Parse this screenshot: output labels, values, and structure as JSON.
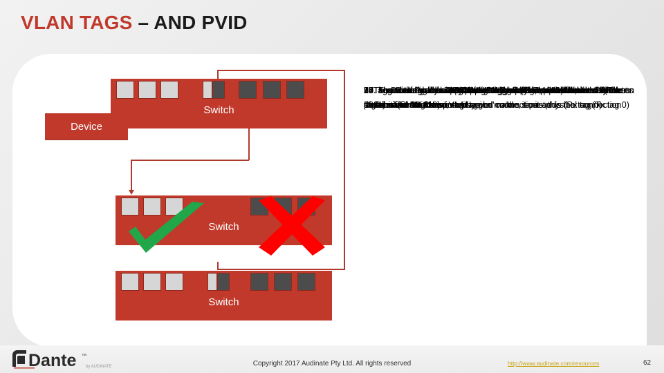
{
  "slide": {
    "title_accent": "VLAN TAGS ",
    "title_plain": "– AND PVID",
    "page_number": "62"
  },
  "colors": {
    "accent_red": "#C0392B",
    "link_red": "#B0392E",
    "untagged_port": "#D6D6D6",
    "tagged_port": "#4C4C4C",
    "tick_green": "#22A64A",
    "cross_red": "#FF0000",
    "title_black": "#1A1A1A",
    "panel_white": "#FFFFFF",
    "footer_link": "#C8A415"
  },
  "diagram": {
    "device": {
      "label": "Device"
    },
    "switches": [
      {
        "label": "Switch",
        "name": "switch-top"
      },
      {
        "label": "Switch",
        "name": "switch-middle"
      },
      {
        "label": "Switch",
        "name": "switch-bottom"
      }
    ],
    "port_types": {
      "untagged": "untagged",
      "tagged": "tagged"
    },
    "marks": {
      "tick": "green-check-mark",
      "cross": "red-cross-mark"
    }
  },
  "body_text": {
    "layers": [
      "13. The Device does not support the frame. The switch does not understand the frame, so it never makes it past this (Rx tag 0)",
      "9. The sender adds a VLAN tag to the frame and sends it out to the switch. The switch is in 'untagged' mode, so it adds the tag (Tx tag 0)",
      "3. The Device sends a PVID of untagged – frames leave and arrive on port this (Rx tag 10)",
      "14. The switch adds a VLAN tag to the packet and sends it on (Tx 1011)",
      "20. The switch has a PVID of 'untagged' (Port 1011) this",
      "15. Frames tagged with the VLAN are only accepted on the Switch Destination MAC and VLAN",
      "10. The switch will forward the VLAN to all the ports that are members of the same VLAN",
      "16. The switch will not tag the address on the ports that are members of the same VLAN",
      "8. The switch ignores any packet with a different VLAN, so only the devices with the same tag can be on the same physical connection",
      "18. The switch only supports the tagged ports of the same VLAN",
      "17. Together Rx and Tx are the PVID setting, so traffic with different tags cannot be transported",
      "7. Tagged traffic does not traverse the Packet, so traffic with different tags can be on the same physical connection"
    ]
  },
  "footer": {
    "copyright": "Copyright 2017 Audinate Pty Ltd. All rights reserved",
    "link": "http://www.audinate.com/resources",
    "logo_text": "Dante",
    "logo_tm": "™"
  }
}
